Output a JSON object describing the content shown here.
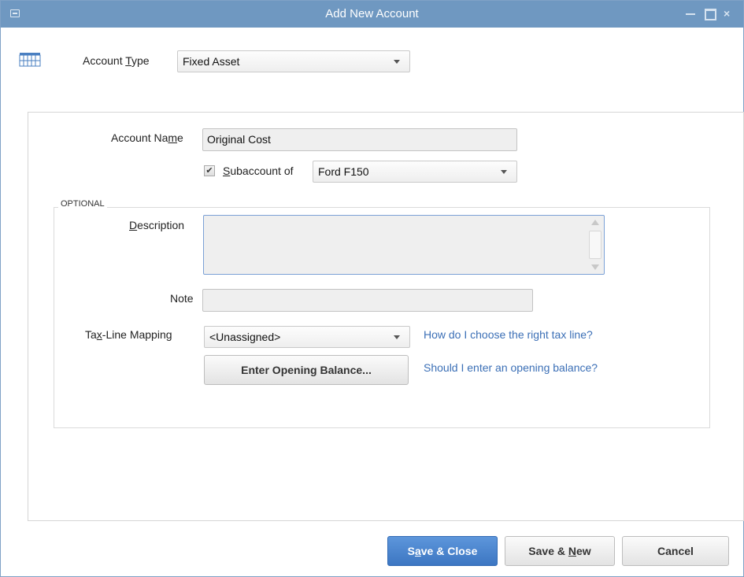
{
  "window": {
    "title": "Add New Account",
    "close_glyph": "×"
  },
  "account_type": {
    "label_pre": "Account ",
    "label_ul": "T",
    "label_post": "ype",
    "value": "Fixed Asset",
    "icon": "account-grid-icon"
  },
  "account_name": {
    "label_pre": "Account Na",
    "label_ul": "m",
    "label_post": "e",
    "value": "Original Cost"
  },
  "subaccount": {
    "checked": true,
    "check_glyph": "✔",
    "label_ul": "S",
    "label_post": "ubaccount of",
    "value": "Ford F150"
  },
  "optional": {
    "heading": "OPTIONAL",
    "description_label_ul": "D",
    "description_label_post": "escription",
    "description_value": "",
    "note_label": "Note",
    "note_value": "",
    "taxline_label_pre": "Ta",
    "taxline_label_ul": "x",
    "taxline_label_post": "-Line Mapping",
    "taxline_value": "<Unassigned>",
    "taxline_help": "How do I choose the right tax line?",
    "opening_balance_pre": "Enter Openin",
    "opening_balance_ul": "g",
    "opening_balance_post": " Balance...",
    "opening_balance_help": "Should I enter an opening balance?"
  },
  "buttons": {
    "save_close_pre": "S",
    "save_close_ul": "a",
    "save_close_post": "ve & Close",
    "save_new_pre": "Save & ",
    "save_new_ul": "N",
    "save_new_post": "ew",
    "cancel": "Cancel"
  },
  "colors": {
    "titlebar": "#6f98c1",
    "primary_button": "#3c76c2",
    "link": "#3b6fb6"
  }
}
